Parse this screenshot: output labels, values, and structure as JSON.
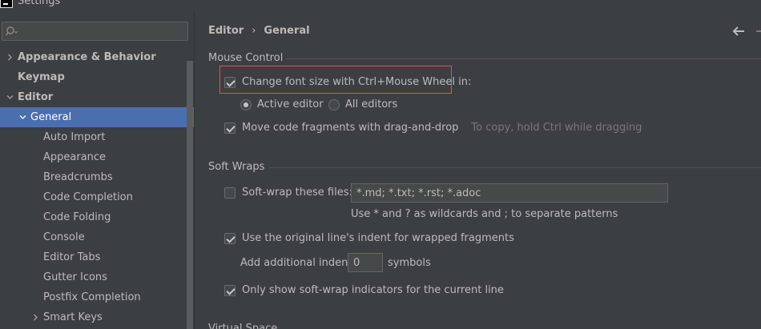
{
  "window": {
    "title": "Settings"
  },
  "search": {
    "placeholder": "",
    "value": ""
  },
  "tree": [
    {
      "label": "Appearance & Behavior",
      "bold": true,
      "arrow": "right",
      "level": 0
    },
    {
      "label": "Keymap",
      "bold": true,
      "arrow": "",
      "level": 0
    },
    {
      "label": "Editor",
      "bold": true,
      "arrow": "down",
      "level": 0
    },
    {
      "label": "General",
      "bold": false,
      "arrow": "down",
      "level": 1,
      "selected": true
    },
    {
      "label": "Auto Import",
      "level": 2
    },
    {
      "label": "Appearance",
      "level": 2
    },
    {
      "label": "Breadcrumbs",
      "level": 2
    },
    {
      "label": "Code Completion",
      "level": 2
    },
    {
      "label": "Code Folding",
      "level": 2
    },
    {
      "label": "Console",
      "level": 2
    },
    {
      "label": "Editor Tabs",
      "level": 2
    },
    {
      "label": "Gutter Icons",
      "level": 2
    },
    {
      "label": "Postfix Completion",
      "level": 2
    },
    {
      "label": "Smart Keys",
      "level": 2,
      "arrow": "right"
    }
  ],
  "breadcrumb": {
    "parent": "Editor",
    "separator": "›",
    "current": "General"
  },
  "mouse_control": {
    "title": "Mouse Control",
    "change_font_size": {
      "label": "Change font size with Ctrl+Mouse Wheel in:",
      "checked": true
    },
    "active_editor": {
      "label": "Active editor",
      "selected": true
    },
    "all_editors": {
      "label": "All editors",
      "selected": false
    },
    "drag_drop": {
      "label": "Move code fragments with drag-and-drop",
      "checked": true,
      "hint": "To copy, hold Ctrl while dragging"
    }
  },
  "soft_wraps": {
    "title": "Soft Wraps",
    "soft_wrap_files": {
      "label": "Soft-wrap these files:",
      "checked": false,
      "value": "*.md; *.txt; *.rst; *.adoc"
    },
    "wildcard_hint": "Use * and ? as wildcards and ; to separate patterns",
    "original_indent": {
      "label": "Use the original line's indent for wrapped fragments",
      "checked": true
    },
    "additional_indent": {
      "label": "Add additional indent:",
      "value": "0",
      "suffix": "symbols"
    },
    "only_current_line": {
      "label": "Only show soft-wrap indicators for the current line",
      "checked": true
    }
  },
  "virtual_space": {
    "title": "Virtual Space"
  },
  "colors": {
    "selection": "#4b6eaf",
    "highlight_border": "#e05252",
    "background": "#3c3f41"
  }
}
